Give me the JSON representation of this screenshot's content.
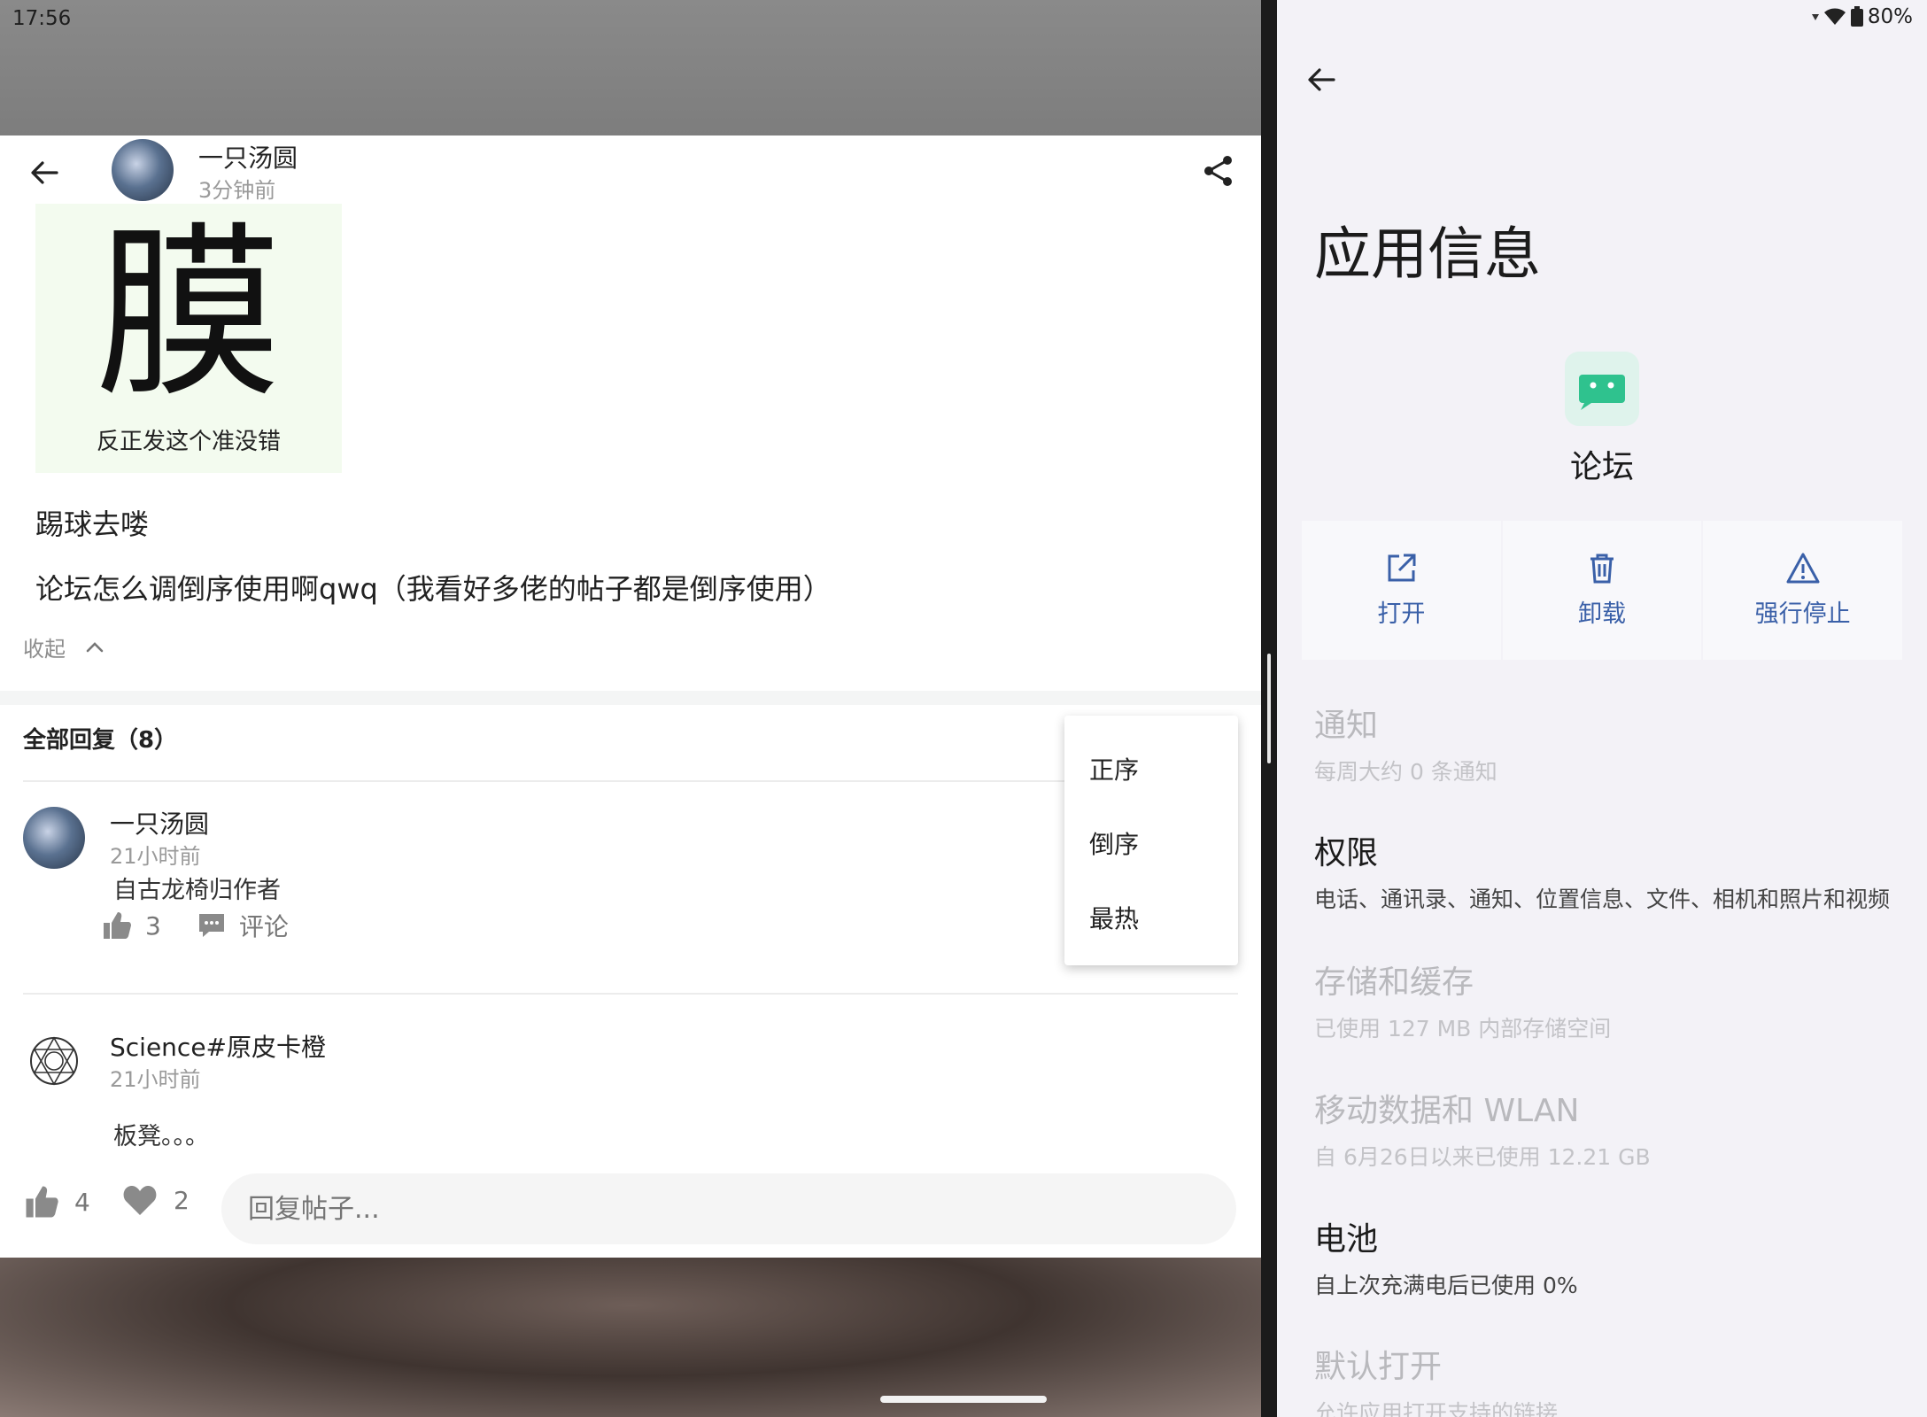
{
  "status_bar": {
    "time": "17:56",
    "battery": "80%"
  },
  "post": {
    "author": "一只汤圆",
    "time": "3分钟前",
    "image_main_char": "膜",
    "image_caption": "反正发这个准没错",
    "line1": "踢球去喽",
    "line2": "论坛怎么调倒序使用啊qwq（我看好多佬的帖子都是倒序使用）",
    "collapse_label": "收起"
  },
  "replies": {
    "header": "全部回复（8）",
    "items": [
      {
        "author": "一只汤圆",
        "time": "21小时前",
        "text": "自古龙椅归作者",
        "likes": "3",
        "comment_label": "评论"
      },
      {
        "author": "Science#原皮卡橙",
        "time": "21小时前",
        "text": "板凳。。。"
      }
    ]
  },
  "sort_menu": {
    "items": [
      "正序",
      "倒序",
      "最热"
    ]
  },
  "bottom_bar": {
    "likes": "4",
    "favorites": "2",
    "reply_placeholder": "回复帖子..."
  },
  "app_info": {
    "title": "应用信息",
    "app_name": "论坛",
    "actions": [
      "打开",
      "卸载",
      "强行停止"
    ],
    "sections": [
      {
        "title": "通知",
        "subtitle": "每周大约 0 条通知",
        "enabled": false
      },
      {
        "title": "权限",
        "subtitle": "电话、通讯录、通知、位置信息、文件、相机和照片和视频",
        "enabled": true
      },
      {
        "title": "存储和缓存",
        "subtitle": "已使用 127 MB 内部存储空间",
        "enabled": false
      },
      {
        "title": "移动数据和 WLAN",
        "subtitle": "自 6月26日以来已使用 12.21 GB",
        "enabled": false
      },
      {
        "title": "电池",
        "subtitle": "自上次充满电后已使用 0%",
        "enabled": true
      },
      {
        "title": "默认打开",
        "subtitle": "允许应用打开支持的链接",
        "enabled": false
      }
    ]
  },
  "colors": {
    "accent": "#3a60a8",
    "app_icon": "#2fc28e"
  }
}
